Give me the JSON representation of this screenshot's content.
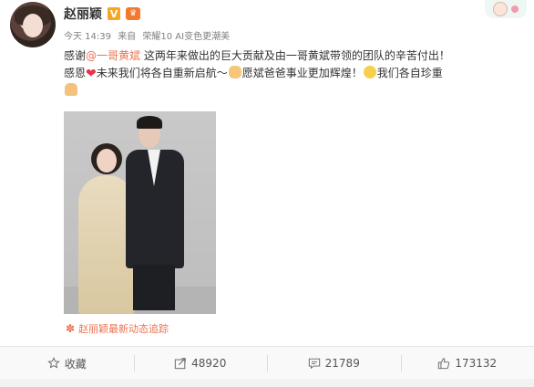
{
  "user": {
    "name": "赵丽颖",
    "verified_badge": "V",
    "avatar_icon": "avatar",
    "vip_icon": "crown-icon"
  },
  "meta": {
    "time": "今天 14:39",
    "source_prefix": "来自",
    "device": "荣耀10 AI变色更潮美"
  },
  "post": {
    "line1_before": "感谢",
    "mention": "@一哥黄斌",
    "line1_after": " 这两年来做出的巨大贡献及由一哥黄斌带领的团队的辛苦付出！",
    "line2_a": "感恩",
    "line2_b": "未来我们将各自重新启航～",
    "line2_c": "愿斌爸爸事业更加辉煌！",
    "line2_d": "我们各自珍重",
    "emoji": [
      "heart",
      "fist",
      "smile",
      "pray"
    ]
  },
  "tracking": {
    "label": "赵丽颖最新动态追踪",
    "icon": "flower-icon"
  },
  "actions": [
    {
      "label": "收藏",
      "icon": "star-icon"
    },
    {
      "label": "48920",
      "icon": "share-icon"
    },
    {
      "label": "21789",
      "icon": "comment-icon"
    },
    {
      "label": "173132",
      "icon": "like-icon"
    }
  ],
  "colors": {
    "accent": "#eb7350",
    "text": "#333333",
    "meta": "#808080"
  }
}
